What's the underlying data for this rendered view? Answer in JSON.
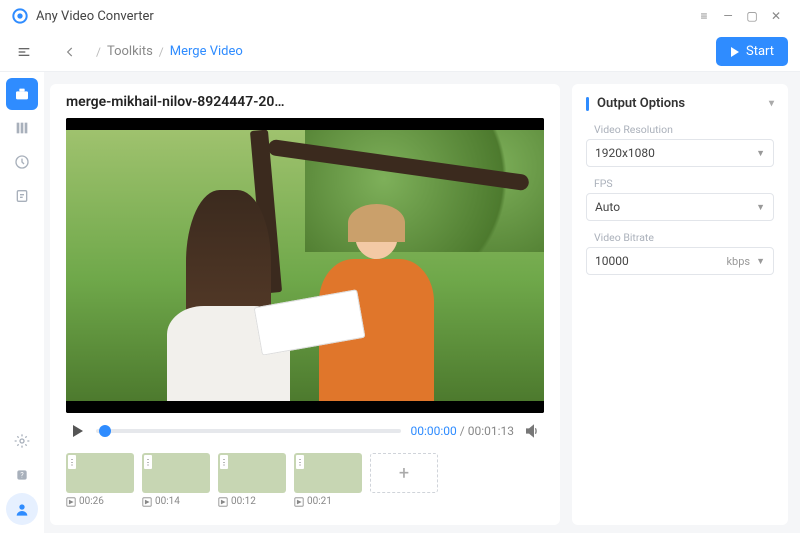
{
  "app": {
    "title": "Any Video Converter"
  },
  "toolbar": {
    "crumb1": "Toolkits",
    "crumb2": "Merge Video",
    "start_label": "Start"
  },
  "file": {
    "title": "merge-mikhail-nilov-8924447-20…"
  },
  "player": {
    "current": "00:00:00",
    "total": "00:01:13"
  },
  "clips": [
    {
      "duration": "00:26"
    },
    {
      "duration": "00:14"
    },
    {
      "duration": "00:12"
    },
    {
      "duration": "00:21"
    }
  ],
  "output": {
    "header": "Output Options",
    "resolution_label": "Video Resolution",
    "resolution_value": "1920x1080",
    "fps_label": "FPS",
    "fps_value": "Auto",
    "bitrate_label": "Video Bitrate",
    "bitrate_value": "10000",
    "bitrate_unit": "kbps"
  }
}
